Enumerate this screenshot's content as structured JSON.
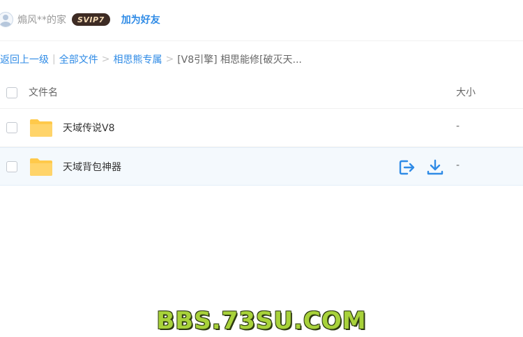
{
  "header": {
    "username": "煽风**的家",
    "vip_badge": "SVIP7",
    "add_friend": "加为好友"
  },
  "breadcrumb": {
    "back": "返回上一级",
    "divider": "|",
    "all_files": "全部文件",
    "sep": ">",
    "folder1": "相思熊专属",
    "current": "[V8引擎] 相思能修[破灭天..."
  },
  "table": {
    "col_name": "文件名",
    "col_size": "大小",
    "rows": [
      {
        "name": "天域传说V8",
        "size": "-"
      },
      {
        "name": "天域背包神器",
        "size": "-"
      }
    ]
  },
  "icons": {
    "folder": "folder-icon",
    "save": "save-to-netdisk-icon",
    "download": "download-icon"
  },
  "colors": {
    "accent": "#2f8be6",
    "folder": "#ffc94a",
    "hover_row": "#f4f9fd"
  },
  "watermark": "BBS.73SU.COM"
}
